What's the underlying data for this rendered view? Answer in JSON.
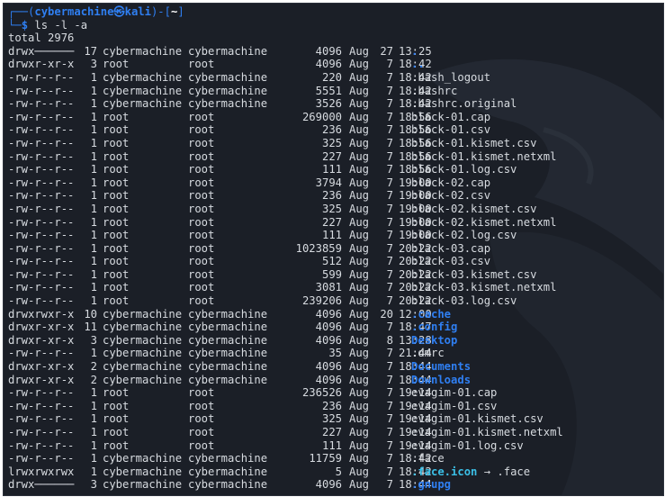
{
  "prompt": {
    "user": "cybermachine",
    "skull": "㉿",
    "host": "kali",
    "path": "~",
    "symbol": "$",
    "command": "ls -l -a"
  },
  "total": "total 2976",
  "entries": [
    {
      "perm": "drwx──────",
      "links": "17",
      "owner": "cybermachine",
      "group": "cybermachine",
      "size": "4096",
      "month": "Aug",
      "day": "27",
      "time": "13:25",
      "name": ".",
      "type": "dir"
    },
    {
      "perm": "drwxr-xr-x",
      "links": "3",
      "owner": "root",
      "group": "root",
      "size": "4096",
      "month": "Aug",
      "day": "7",
      "time": "18:42",
      "name": "..",
      "type": "dir"
    },
    {
      "perm": "-rw-r--r--",
      "links": "1",
      "owner": "cybermachine",
      "group": "cybermachine",
      "size": "220",
      "month": "Aug",
      "day": "7",
      "time": "18:42",
      "name": ".bash_logout",
      "type": "file"
    },
    {
      "perm": "-rw-r--r--",
      "links": "1",
      "owner": "cybermachine",
      "group": "cybermachine",
      "size": "5551",
      "month": "Aug",
      "day": "7",
      "time": "18:42",
      "name": ".bashrc",
      "type": "file"
    },
    {
      "perm": "-rw-r--r--",
      "links": "1",
      "owner": "cybermachine",
      "group": "cybermachine",
      "size": "3526",
      "month": "Aug",
      "day": "7",
      "time": "18:42",
      "name": ".bashrc.original",
      "type": "file"
    },
    {
      "perm": "-rw-r--r--",
      "links": "1",
      "owner": "root",
      "group": "root",
      "size": "269000",
      "month": "Aug",
      "day": "7",
      "time": "18:56",
      "name": "black-01.cap",
      "type": "file"
    },
    {
      "perm": "-rw-r--r--",
      "links": "1",
      "owner": "root",
      "group": "root",
      "size": "236",
      "month": "Aug",
      "day": "7",
      "time": "18:56",
      "name": "black-01.csv",
      "type": "file"
    },
    {
      "perm": "-rw-r--r--",
      "links": "1",
      "owner": "root",
      "group": "root",
      "size": "325",
      "month": "Aug",
      "day": "7",
      "time": "18:56",
      "name": "black-01.kismet.csv",
      "type": "file"
    },
    {
      "perm": "-rw-r--r--",
      "links": "1",
      "owner": "root",
      "group": "root",
      "size": "227",
      "month": "Aug",
      "day": "7",
      "time": "18:56",
      "name": "black-01.kismet.netxml",
      "type": "file"
    },
    {
      "perm": "-rw-r--r--",
      "links": "1",
      "owner": "root",
      "group": "root",
      "size": "111",
      "month": "Aug",
      "day": "7",
      "time": "18:56",
      "name": "black-01.log.csv",
      "type": "file"
    },
    {
      "perm": "-rw-r--r--",
      "links": "1",
      "owner": "root",
      "group": "root",
      "size": "3794",
      "month": "Aug",
      "day": "7",
      "time": "19:00",
      "name": "black-02.cap",
      "type": "file"
    },
    {
      "perm": "-rw-r--r--",
      "links": "1",
      "owner": "root",
      "group": "root",
      "size": "236",
      "month": "Aug",
      "day": "7",
      "time": "19:00",
      "name": "black-02.csv",
      "type": "file"
    },
    {
      "perm": "-rw-r--r--",
      "links": "1",
      "owner": "root",
      "group": "root",
      "size": "325",
      "month": "Aug",
      "day": "7",
      "time": "19:00",
      "name": "black-02.kismet.csv",
      "type": "file"
    },
    {
      "perm": "-rw-r--r--",
      "links": "1",
      "owner": "root",
      "group": "root",
      "size": "227",
      "month": "Aug",
      "day": "7",
      "time": "19:00",
      "name": "black-02.kismet.netxml",
      "type": "file"
    },
    {
      "perm": "-rw-r--r--",
      "links": "1",
      "owner": "root",
      "group": "root",
      "size": "111",
      "month": "Aug",
      "day": "7",
      "time": "19:00",
      "name": "black-02.log.csv",
      "type": "file"
    },
    {
      "perm": "-rw-r--r--",
      "links": "1",
      "owner": "root",
      "group": "root",
      "size": "1023859",
      "month": "Aug",
      "day": "7",
      "time": "20:22",
      "name": "black-03.cap",
      "type": "file"
    },
    {
      "perm": "-rw-r--r--",
      "links": "1",
      "owner": "root",
      "group": "root",
      "size": "512",
      "month": "Aug",
      "day": "7",
      "time": "20:22",
      "name": "black-03.csv",
      "type": "file"
    },
    {
      "perm": "-rw-r--r--",
      "links": "1",
      "owner": "root",
      "group": "root",
      "size": "599",
      "month": "Aug",
      "day": "7",
      "time": "20:22",
      "name": "black-03.kismet.csv",
      "type": "file"
    },
    {
      "perm": "-rw-r--r--",
      "links": "1",
      "owner": "root",
      "group": "root",
      "size": "3081",
      "month": "Aug",
      "day": "7",
      "time": "20:22",
      "name": "black-03.kismet.netxml",
      "type": "file"
    },
    {
      "perm": "-rw-r--r--",
      "links": "1",
      "owner": "root",
      "group": "root",
      "size": "239206",
      "month": "Aug",
      "day": "7",
      "time": "20:22",
      "name": "black-03.log.csv",
      "type": "file"
    },
    {
      "perm": "drwxrwxr-x",
      "links": "10",
      "owner": "cybermachine",
      "group": "cybermachine",
      "size": "4096",
      "month": "Aug",
      "day": "20",
      "time": "12:00",
      "name": ".cache",
      "type": "dir"
    },
    {
      "perm": "drwxr-xr-x",
      "links": "11",
      "owner": "cybermachine",
      "group": "cybermachine",
      "size": "4096",
      "month": "Aug",
      "day": "7",
      "time": "18:47",
      "name": ".config",
      "type": "dir"
    },
    {
      "perm": "drwxr-xr-x",
      "links": "3",
      "owner": "cybermachine",
      "group": "cybermachine",
      "size": "4096",
      "month": "Aug",
      "day": "8",
      "time": "13:28",
      "name": "Desktop",
      "type": "dir"
    },
    {
      "perm": "-rw-r--r--",
      "links": "1",
      "owner": "cybermachine",
      "group": "cybermachine",
      "size": "35",
      "month": "Aug",
      "day": "7",
      "time": "21:44",
      "name": ".dmrc",
      "type": "file"
    },
    {
      "perm": "drwxr-xr-x",
      "links": "2",
      "owner": "cybermachine",
      "group": "cybermachine",
      "size": "4096",
      "month": "Aug",
      "day": "7",
      "time": "18:44",
      "name": "Documents",
      "type": "dir"
    },
    {
      "perm": "drwxr-xr-x",
      "links": "2",
      "owner": "cybermachine",
      "group": "cybermachine",
      "size": "4096",
      "month": "Aug",
      "day": "7",
      "time": "18:44",
      "name": "Downloads",
      "type": "dir"
    },
    {
      "perm": "-rw-r--r--",
      "links": "1",
      "owner": "root",
      "group": "root",
      "size": "236526",
      "month": "Aug",
      "day": "7",
      "time": "19:14",
      "name": "evagim-01.cap",
      "type": "file"
    },
    {
      "perm": "-rw-r--r--",
      "links": "1",
      "owner": "root",
      "group": "root",
      "size": "236",
      "month": "Aug",
      "day": "7",
      "time": "19:14",
      "name": "evagim-01.csv",
      "type": "file"
    },
    {
      "perm": "-rw-r--r--",
      "links": "1",
      "owner": "root",
      "group": "root",
      "size": "325",
      "month": "Aug",
      "day": "7",
      "time": "19:14",
      "name": "evagim-01.kismet.csv",
      "type": "file"
    },
    {
      "perm": "-rw-r--r--",
      "links": "1",
      "owner": "root",
      "group": "root",
      "size": "227",
      "month": "Aug",
      "day": "7",
      "time": "19:14",
      "name": "evagim-01.kismet.netxml",
      "type": "file"
    },
    {
      "perm": "-rw-r--r--",
      "links": "1",
      "owner": "root",
      "group": "root",
      "size": "111",
      "month": "Aug",
      "day": "7",
      "time": "19:14",
      "name": "evagim-01.log.csv",
      "type": "file"
    },
    {
      "perm": "-rw-r--r--",
      "links": "1",
      "owner": "cybermachine",
      "group": "cybermachine",
      "size": "11759",
      "month": "Aug",
      "day": "7",
      "time": "18:42",
      "name": ".face",
      "type": "file"
    },
    {
      "perm": "lrwxrwxrwx",
      "links": "1",
      "owner": "cybermachine",
      "group": "cybermachine",
      "size": "5",
      "month": "Aug",
      "day": "7",
      "time": "18:42",
      "name": ".face.icon",
      "type": "link",
      "target": ".face",
      "arrow": "→"
    },
    {
      "perm": "drwx──────",
      "links": "3",
      "owner": "cybermachine",
      "group": "cybermachine",
      "size": "4096",
      "month": "Aug",
      "day": "7",
      "time": "18:44",
      "name": ".gnupg",
      "type": "dir"
    }
  ],
  "colors": {
    "background": "#1b1f27",
    "text": "#d7dbe0",
    "directory": "#2f7ff2",
    "symlink": "#3bbfe6",
    "prompt": "#2f7ff2"
  }
}
